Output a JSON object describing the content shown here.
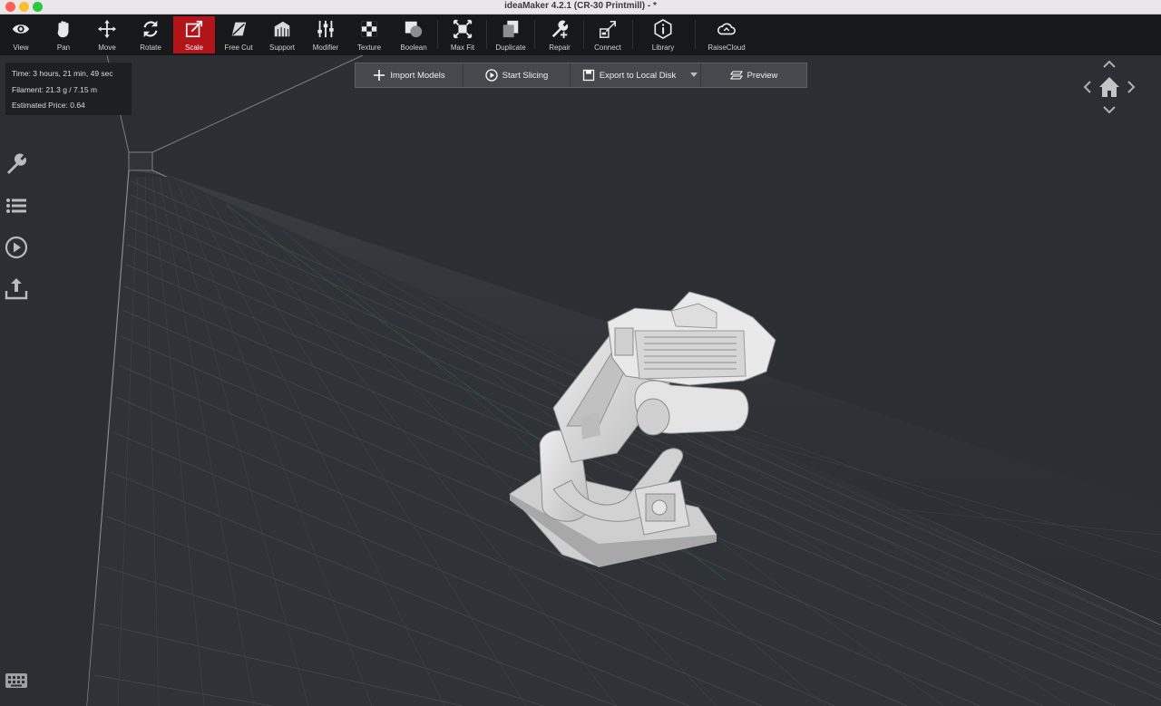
{
  "window": {
    "title": "ideaMaker 4.2.1 (CR-30 Printmill) - *"
  },
  "toolbar": {
    "tools": [
      {
        "label": "View",
        "icon": "eye-icon"
      },
      {
        "label": "Pan",
        "icon": "hand-icon"
      },
      {
        "label": "Move",
        "icon": "move-arrows-icon"
      },
      {
        "label": "Rotate",
        "icon": "rotate-icon"
      },
      {
        "label": "Scale",
        "icon": "scale-icon",
        "active": true
      },
      {
        "label": "Free Cut",
        "icon": "free-cut-icon"
      },
      {
        "label": "Support",
        "icon": "support-icon"
      },
      {
        "label": "Modifier",
        "icon": "sliders-icon"
      },
      {
        "label": "Texture",
        "icon": "checker-icon"
      },
      {
        "label": "Boolean",
        "icon": "boolean-icon"
      },
      {
        "label": "Max Fit",
        "icon": "max-fit-icon"
      },
      {
        "label": "Duplicate",
        "icon": "duplicate-icon"
      },
      {
        "label": "Repair",
        "icon": "wrench-plus-icon"
      },
      {
        "label": "Connect",
        "icon": "connect-icon"
      },
      {
        "label": "Library",
        "icon": "library-hex-icon"
      },
      {
        "label": "RaiseCloud",
        "icon": "cloud-icon"
      }
    ],
    "active_color": "#b3141a"
  },
  "info_panel": {
    "time": "Time: 3 hours, 21 min, 49 sec",
    "filament": "Filament: 21.3 g / 7.15 m",
    "price": "Estimated Price: 0.64"
  },
  "action_bar": {
    "import_label": "Import Models",
    "slice_label": "Start Slicing",
    "export_label": "Export to Local Disk",
    "preview_label": "Preview"
  },
  "sidebar": {
    "icons": [
      "wrench-icon",
      "list-icon",
      "play-circle-icon",
      "upload-icon"
    ]
  },
  "colors": {
    "toolbar_bg": "#161819",
    "viewport_bg": "#2b2f33",
    "model": "#d9d9d9"
  }
}
